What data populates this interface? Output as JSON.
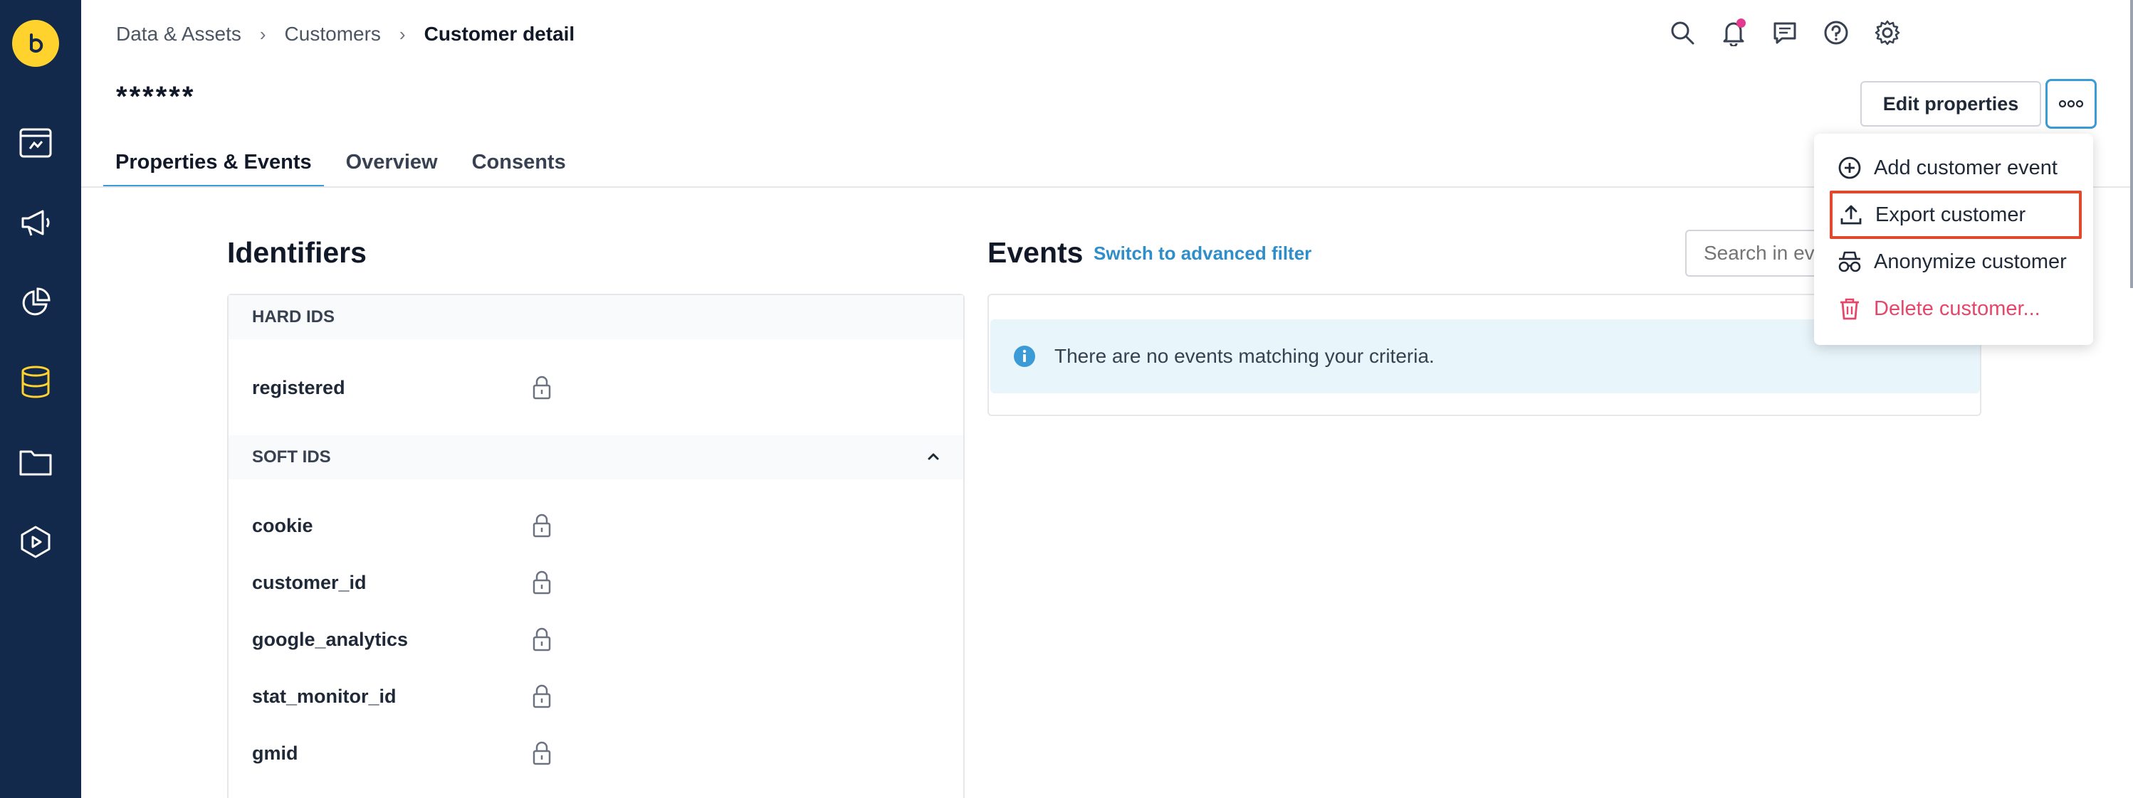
{
  "breadcrumb": {
    "items": [
      "Data & Assets",
      "Customers"
    ],
    "current": "Customer detail"
  },
  "page": {
    "title": "******"
  },
  "toolbar": {
    "edit_label": "Edit properties"
  },
  "tabs": [
    {
      "label": "Properties & Events",
      "active": true
    },
    {
      "label": "Overview",
      "active": false
    },
    {
      "label": "Consents",
      "active": false
    }
  ],
  "identifiers": {
    "title": "Identifiers",
    "hard_ids_label": "HARD IDS",
    "hard_ids": [
      "registered"
    ],
    "soft_ids_label": "SOFT IDS",
    "soft_ids": [
      "cookie",
      "customer_id",
      "google_analytics",
      "stat_monitor_id",
      "gmid"
    ]
  },
  "events": {
    "title": "Events",
    "advanced_filter_label": "Switch to advanced filter",
    "search_placeholder": "Search in events",
    "empty_message": "There are no events matching your criteria."
  },
  "menu": {
    "items": [
      {
        "label": "Add customer event",
        "icon": "plus-circle-icon"
      },
      {
        "label": "Export customer",
        "icon": "upload-icon"
      },
      {
        "label": "Anonymize customer",
        "icon": "spy-icon"
      },
      {
        "label": "Delete customer...",
        "icon": "trash-icon"
      }
    ]
  },
  "colors": {
    "sidebar": "#13294b",
    "brand_yellow": "#ffd22e",
    "accent_blue": "#3b9bd6",
    "danger": "#e5476a",
    "highlight_border": "#e04a2c"
  }
}
